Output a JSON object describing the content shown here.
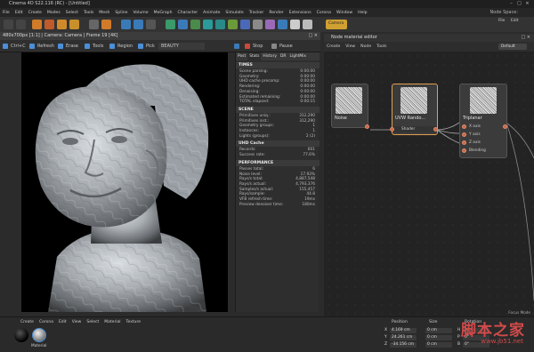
{
  "window": {
    "title": "Cinema 4D S22.116 (RC) - [Untitled]",
    "controls": [
      "–",
      "□",
      "×"
    ]
  },
  "menubar": {
    "items": [
      "File",
      "Edit",
      "Create",
      "Modes",
      "Select",
      "Tools",
      "Mesh",
      "Spline",
      "Volume",
      "MoGraph",
      "Character",
      "Animate",
      "Simulate",
      "Tracker",
      "Render",
      "Extensions",
      "Corona",
      "Window",
      "Help"
    ],
    "right_label": "Node Space:"
  },
  "right_toolbar": {
    "items": [
      "Camera",
      "File",
      "Edit"
    ]
  },
  "render_viewer": {
    "title": "480x700px [1:1] | Camera: Camera | Frame 19 [4K]",
    "tools": {
      "ctrl_c": "Ctrl+C",
      "refresh": "Refresh",
      "erase": "Erase",
      "tools": "Tools",
      "region": "Region",
      "pick": "Pick",
      "pass": "BEAUTY",
      "stop": "Stop",
      "pause": "Pause"
    }
  },
  "stats_panel": {
    "tabs": [
      "Post",
      "Stats",
      "History",
      "DR",
      "LightMix"
    ],
    "sections": [
      {
        "title": "TIMES",
        "rows": [
          {
            "label": "Scene parsing:",
            "value": "0:00:00"
          },
          {
            "label": "Geometry:",
            "value": "0:00:00"
          },
          {
            "label": "UHD cache precomp:",
            "value": "0:00:00"
          },
          {
            "label": "Rendering:",
            "value": "0:00:00"
          },
          {
            "label": "Denoising:",
            "value": "0:00:00"
          },
          {
            "label": "Estimated remaining:",
            "value": "0:00:00"
          },
          {
            "label": "TOTAL elapsed:",
            "value": "0:00:15"
          }
        ]
      },
      {
        "title": "SCENE",
        "rows": [
          {
            "label": "Primitives uniq.:",
            "value": "312,290"
          },
          {
            "label": "Primitives inst.:",
            "value": "312,290"
          },
          {
            "label": "Geometry groups:",
            "value": "1"
          },
          {
            "label": "Instances:",
            "value": "1"
          },
          {
            "label": "Lights (groups):",
            "value": "2 (2)"
          }
        ]
      },
      {
        "title": "UHD Cache",
        "rows": [
          {
            "label": "Records:",
            "value": "601"
          },
          {
            "label": "Success rate:",
            "value": "77.6%"
          }
        ]
      },
      {
        "title": "PERFORMANCE",
        "rows": [
          {
            "label": "Passes total:",
            "value": "6"
          },
          {
            "label": "Noise level:",
            "value": "17.93%"
          },
          {
            "label": "Rays/s total:",
            "value": "4,887,548"
          },
          {
            "label": "Rays/s actual:",
            "value": "4,793,376"
          },
          {
            "label": "Samples/s actual:",
            "value": "155,457"
          },
          {
            "label": "Rays/sample:",
            "value": "44.8"
          },
          {
            "label": "VFB refresh time:",
            "value": "19ms"
          },
          {
            "label": "Preview denoiser time:",
            "value": "180ms"
          }
        ]
      }
    ]
  },
  "node_editor": {
    "title": "Node material editor",
    "menu": [
      "Create",
      "View",
      "Node",
      "Tools"
    ],
    "dropdown": "Default",
    "nodes": [
      {
        "name": "Noise"
      },
      {
        "name": "UVW Rando...",
        "ports": [
          "Shader"
        ]
      },
      {
        "name": "Triplanar",
        "ports": [
          "X axis",
          "Y axis",
          "Z axis",
          "Blending"
        ]
      }
    ],
    "side_label": "Focus Mode"
  },
  "material_panel": {
    "menu": [
      "Create",
      "Corona",
      "Edit",
      "View",
      "Select",
      "Material",
      "Texture"
    ],
    "material_label": "Material"
  },
  "coord_panel": {
    "headers": [
      "Position",
      "Size",
      "Rotation"
    ],
    "rows": [
      {
        "axis": "X",
        "position": "4.169 cm",
        "size": "0 cm",
        "rot_axis": "H",
        "rot": "0°"
      },
      {
        "axis": "Y",
        "position": "24.261 cm",
        "size": "0 cm",
        "rot_axis": "P",
        "rot": "0°"
      },
      {
        "axis": "Z",
        "position": "-34.156 cm",
        "size": "0 cm",
        "rot_axis": "B",
        "rot": "0°"
      }
    ]
  },
  "watermark": {
    "text": "脚本之家",
    "url": "www.jb51.net"
  },
  "colors": {
    "accent": "#4a8fd8",
    "node_selected": "#e0a050",
    "port": "#c96a4a",
    "watermark": "#d04a4a"
  }
}
